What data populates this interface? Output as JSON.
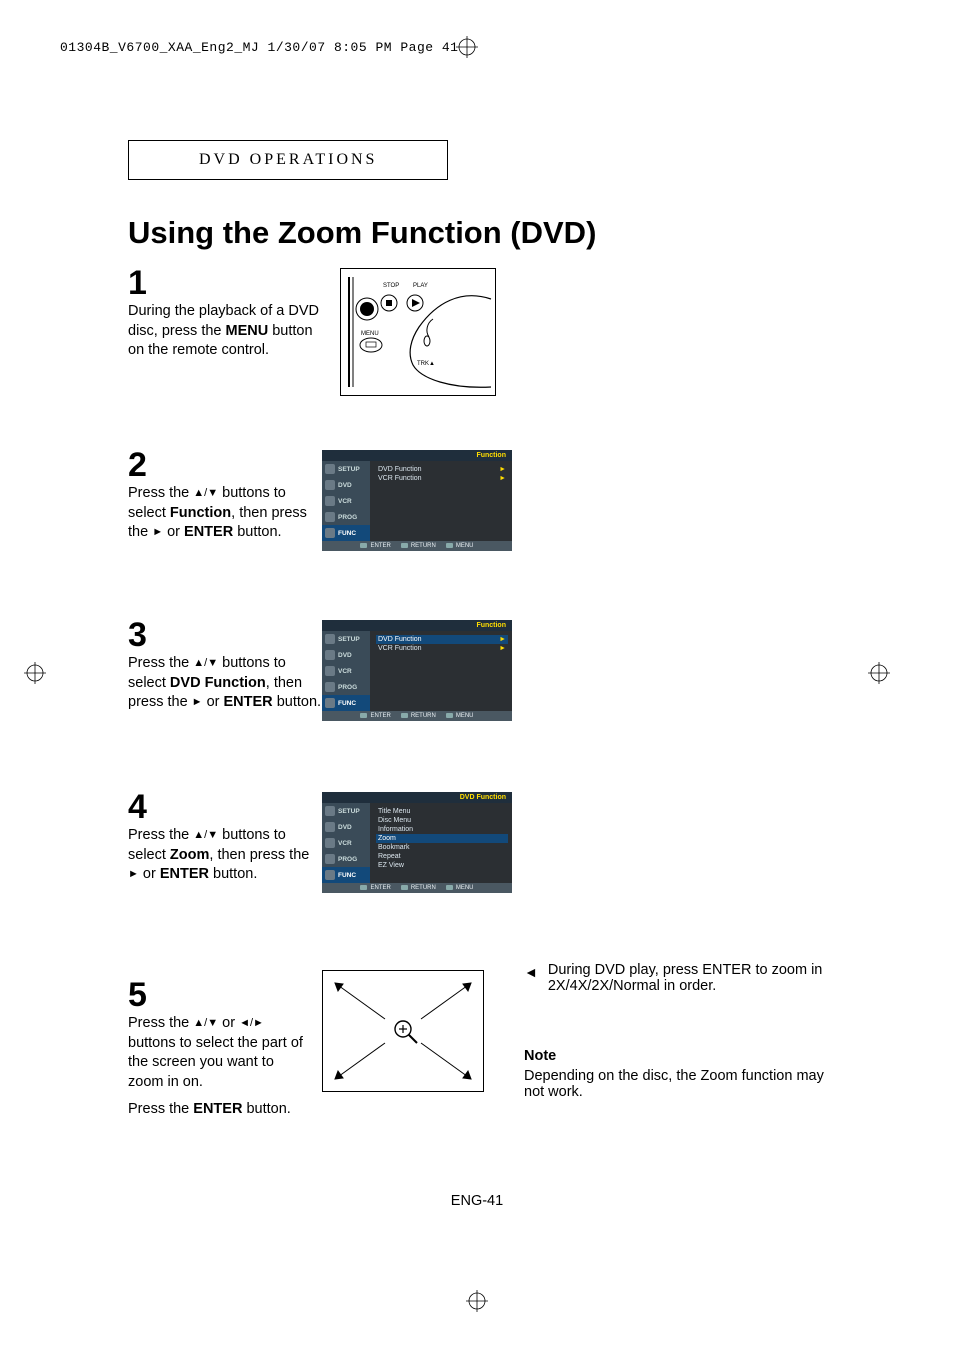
{
  "header_line": "01304B_V6700_XAA_Eng2_MJ  1/30/07  8:05 PM  Page 41",
  "section_label": "DVD OPERATIONS",
  "title": "Using the Zoom Function (DVD)",
  "steps": {
    "s1": {
      "num": "1",
      "text_a": "During the playback of a DVD disc, press the ",
      "bold1": "MENU",
      "text_b": " button on the remote control."
    },
    "s2": {
      "num": "2",
      "text_a": "Press the ",
      "arrows1": "▲/▼",
      "text_b": " buttons to select ",
      "bold1": "Function",
      "text_c": ", then press the ",
      "arrow_r": "►",
      "text_d": " or ",
      "bold2": "ENTER",
      "text_e": " button."
    },
    "s3": {
      "num": "3",
      "text_a": "Press the ",
      "arrows1": "▲/▼",
      "text_b": " buttons to select ",
      "bold1": "DVD Function",
      "text_c": ", then press the ",
      "arrow_r": "►",
      "text_d": " or ",
      "bold2": "ENTER",
      "text_e": " button."
    },
    "s4": {
      "num": "4",
      "text_a": "Press the ",
      "arrows1": "▲/▼",
      "text_b": " buttons to select ",
      "bold1": "Zoom",
      "text_c": ", then press the ",
      "arrow_r": "►",
      "text_d": " or ",
      "bold2": "ENTER",
      "text_e": " button."
    },
    "s5": {
      "num": "5",
      "text_a": "Press the ",
      "arrows1": "▲/▼",
      "text_b": " or ",
      "arrows2": "◄/►",
      "text_c": " buttons to select the part of the screen you want to zoom in on.",
      "text_d": "Press the ",
      "bold1": "ENTER",
      "text_e": " button."
    }
  },
  "osd_side": [
    "SETUP",
    "DVD",
    "VCR",
    "PROG",
    "FUNC"
  ],
  "osd2": {
    "header": "Function",
    "rows": [
      "DVD Function",
      "VCR Function"
    ],
    "sel_index": -1
  },
  "osd3": {
    "header": "Function",
    "rows": [
      "DVD Function",
      "VCR Function"
    ],
    "sel_index": 0
  },
  "osd4": {
    "header": "DVD Function",
    "rows": [
      "Title Menu",
      "Disc Menu",
      "Information",
      "Zoom",
      "Bookmark",
      "Repeat",
      "EZ View"
    ],
    "sel_index": 3
  },
  "osd_footer": [
    "ENTER",
    "RETURN",
    "MENU"
  ],
  "side_note": {
    "marker": "◄",
    "line1": "During DVD play, press ENTER to zoom in 2X/4X/2X/Normal in order.",
    "note_hd": "Note",
    "note_body": "Depending on the disc, the Zoom function may not work."
  },
  "remote": {
    "stop": "STOP",
    "play": "PLAY",
    "menu": "MENU",
    "trk": "TRK▲"
  },
  "page_num": "ENG-41"
}
